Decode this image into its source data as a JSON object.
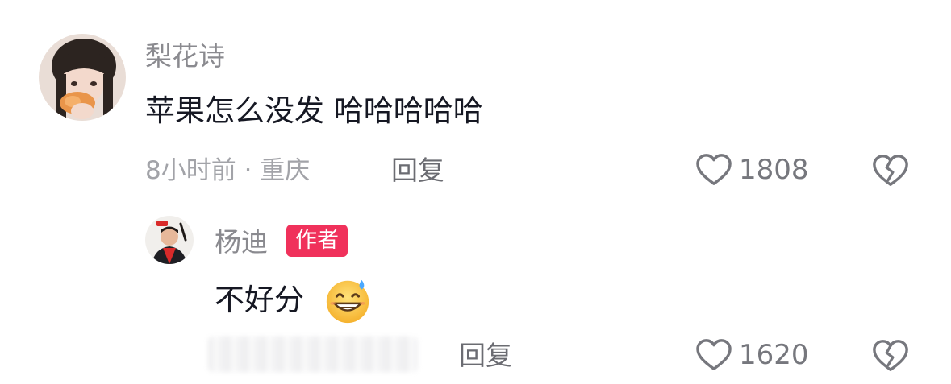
{
  "comments": [
    {
      "username": "梨花诗",
      "content": "苹果怎么没发 哈哈哈哈哈",
      "meta": "8小时前 · 重庆",
      "reply_label": "回复",
      "like_count": "1808",
      "avatar_icon": "user-avatar-photo"
    }
  ],
  "replies": [
    {
      "username": "杨迪",
      "badge": "作者",
      "content": "不好分",
      "emoji": "grinning-sweat-emoji",
      "reply_label": "回复",
      "like_count": "1620",
      "avatar_icon": "author-avatar-photo"
    }
  ],
  "colors": {
    "badge": "#f0315b",
    "username": "#8a8a8f",
    "text": "#161823",
    "meta": "#a2a3a8"
  }
}
